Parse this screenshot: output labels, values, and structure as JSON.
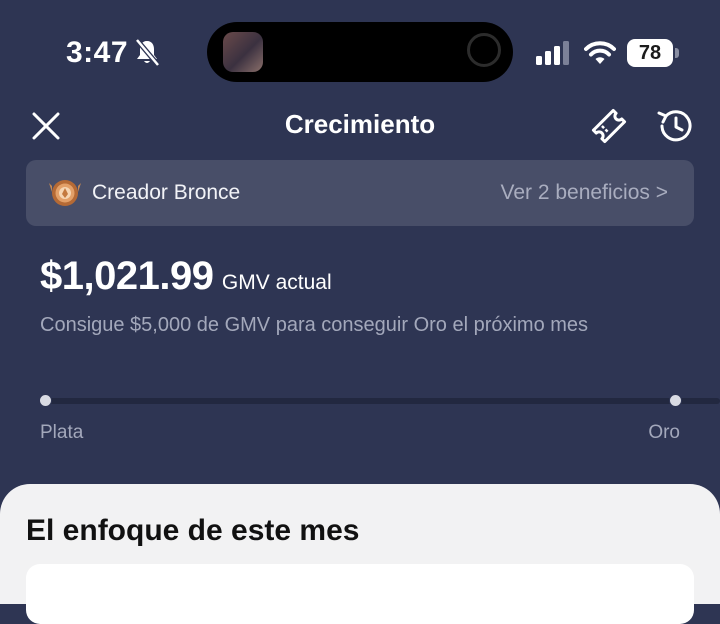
{
  "status_bar": {
    "time": "3:47",
    "battery": "78",
    "icons": [
      "bell-slash-icon",
      "signal-icon",
      "wifi-icon",
      "battery-icon"
    ]
  },
  "nav": {
    "title": "Crecimiento",
    "icons": [
      "close-icon",
      "ticket-icon",
      "history-icon"
    ]
  },
  "tier": {
    "name": "Creador Bronce",
    "benefits_link": "Ver 2 beneficios >",
    "icon": "bronze-medal-icon"
  },
  "gmv": {
    "amount": "$1,021.99",
    "label": "GMV actual",
    "goal_text": "Consigue $5,000 de GMV para conseguir Oro el próximo mes"
  },
  "progress": {
    "start_label": "Plata",
    "end_label": "Oro",
    "fraction": 0
  },
  "sheet": {
    "title": "El enfoque de este mes"
  },
  "colors": {
    "background": "#2e3553",
    "card": "#484e68",
    "muted_text": "#a3a8bb",
    "sheet": "#f2f2f3"
  }
}
